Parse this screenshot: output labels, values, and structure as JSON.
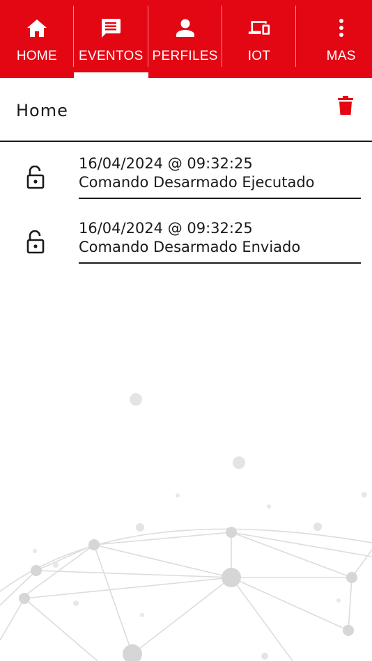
{
  "tabs": [
    {
      "label": "HOME",
      "icon": "home-icon",
      "active": false
    },
    {
      "label": "EVENTOS",
      "icon": "chat-icon",
      "active": true
    },
    {
      "label": "PERFILES",
      "icon": "person-icon",
      "active": false
    },
    {
      "label": "IOT",
      "icon": "devices-icon",
      "active": false
    },
    {
      "label": "MAS",
      "icon": "more-vertical-icon",
      "active": false
    }
  ],
  "header": {
    "title": "Home",
    "delete_icon": "trash-icon"
  },
  "events": [
    {
      "timestamp": "16/04/2024 @ 09:32:25",
      "message": "Comando Desarmado Ejecutado",
      "icon": "lock-open-icon"
    },
    {
      "timestamp": "16/04/2024 @ 09:32:25",
      "message": "Comando Desarmado Enviado",
      "icon": "lock-open-icon"
    }
  ],
  "colors": {
    "brand_red": "#e30613",
    "text": "#1a1a1a",
    "background": "#ffffff",
    "network_gray": "#d6d6d6"
  }
}
